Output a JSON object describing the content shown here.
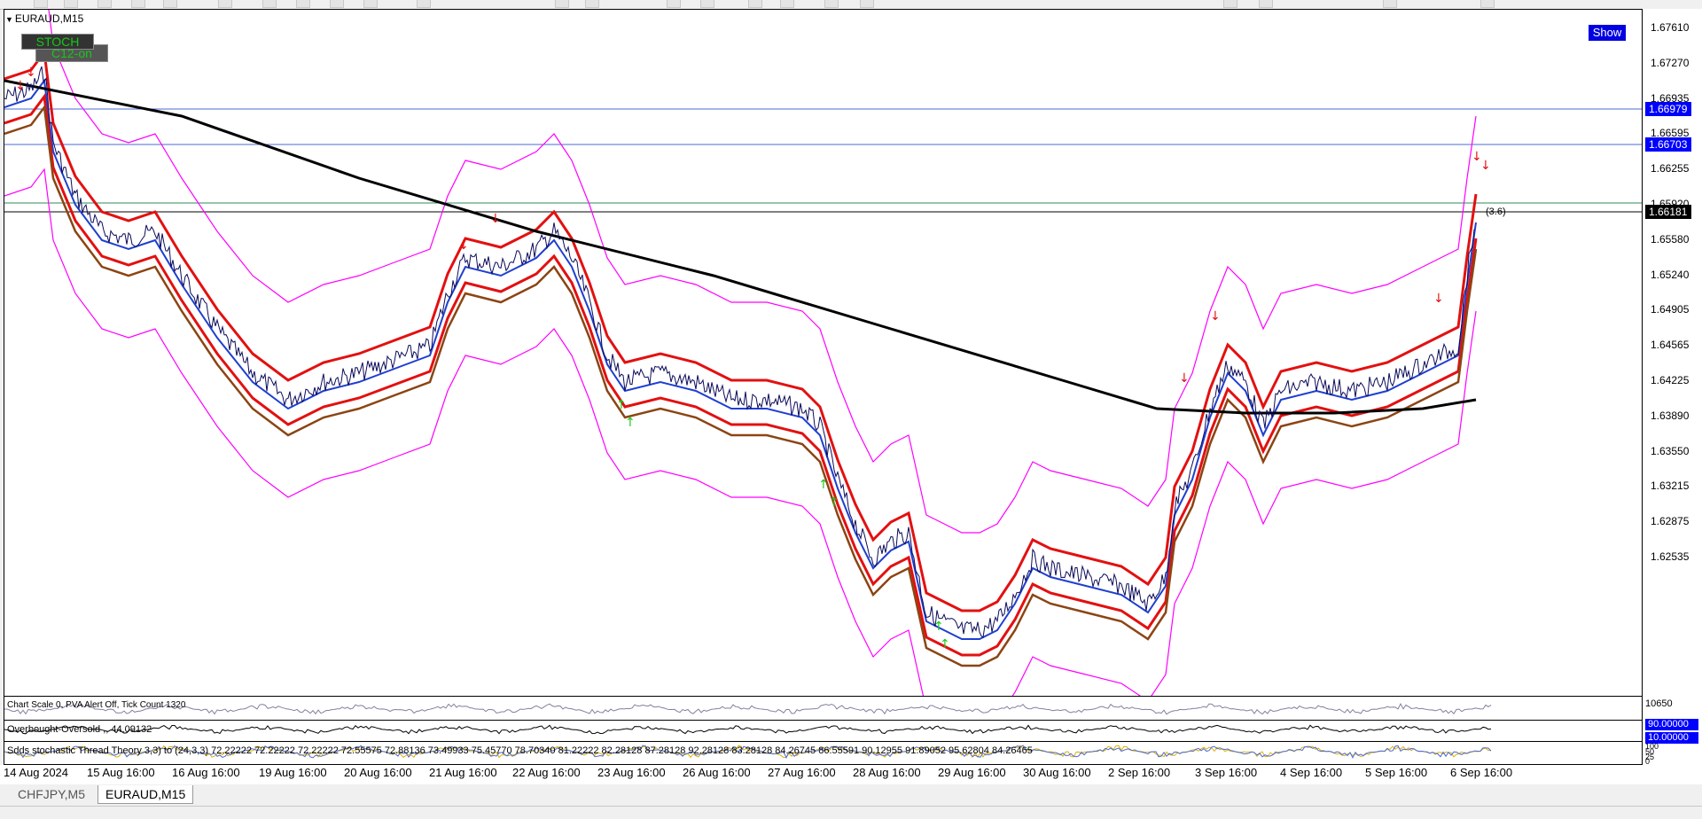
{
  "chart": {
    "symbol_title": "EURAUD,M15",
    "stoch_label": "STOCH",
    "c12_label": "C12-on",
    "show_button": "Show",
    "price_levels": [
      "1.67610",
      "1.67270",
      "1.66935",
      "1.66595",
      "1.66255",
      "1.65920",
      "1.65580",
      "1.65240",
      "1.64905",
      "1.64565",
      "1.64225",
      "1.63890",
      "1.63550",
      "1.63215",
      "1.62875",
      "1.62535"
    ],
    "price_tags": {
      "line1": "1.66979",
      "line2": "1.66703",
      "current": "1.66181",
      "label_near_price": "(3.6)"
    },
    "colors": {
      "line_blue": "#4b6bd6",
      "tag_blue": "#0000ff",
      "red_band": "#e31010",
      "magenta_band": "#ff00ff",
      "ma_black": "#000000",
      "ma_brown": "#8b4513",
      "price_navy": "#0b0b5a",
      "green_arrows": "#18c818"
    }
  },
  "indicators": {
    "info_line": "Chart Scale  0,  PVA Alert Off,  Tick Count  1320",
    "sub1_label": "Overbought-Oversold  ,,  44.09132",
    "sub2_label": "Sdds stochastic  Thread Theory 3,3) to (24,3,3) 72.22222 72.22222 72.22222 72.55575 72.88136 73.49933 75.45770 78.70340 81.22222 82.28128 87.28128 92.28128 83.28128 84.26745 86.55591 90.12955 91.89052 95.62804 84.26465",
    "sub_scale_top": "10650",
    "sub_scale_blue1": "90.00000",
    "sub_scale_blue2": "10.00000",
    "sub_scale_small": [
      "100",
      "50",
      "25",
      "0"
    ]
  },
  "time_axis": [
    "14 Aug 2024",
    "15 Aug 16:00",
    "16 Aug 16:00",
    "19 Aug 16:00",
    "20 Aug 16:00",
    "21 Aug 16:00",
    "22 Aug 16:00",
    "23 Aug 16:00",
    "26 Aug 16:00",
    "27 Aug 16:00",
    "28 Aug 16:00",
    "29 Aug 16:00",
    "30 Aug 16:00",
    "2 Sep 16:00",
    "3 Sep 16:00",
    "4 Sep 16:00",
    "5 Sep 16:00",
    "6 Sep 16:00"
  ],
  "tabs": [
    {
      "label": "CHFJPY,M5",
      "active": false
    },
    {
      "label": "EURAUD,M15",
      "active": true
    }
  ]
}
